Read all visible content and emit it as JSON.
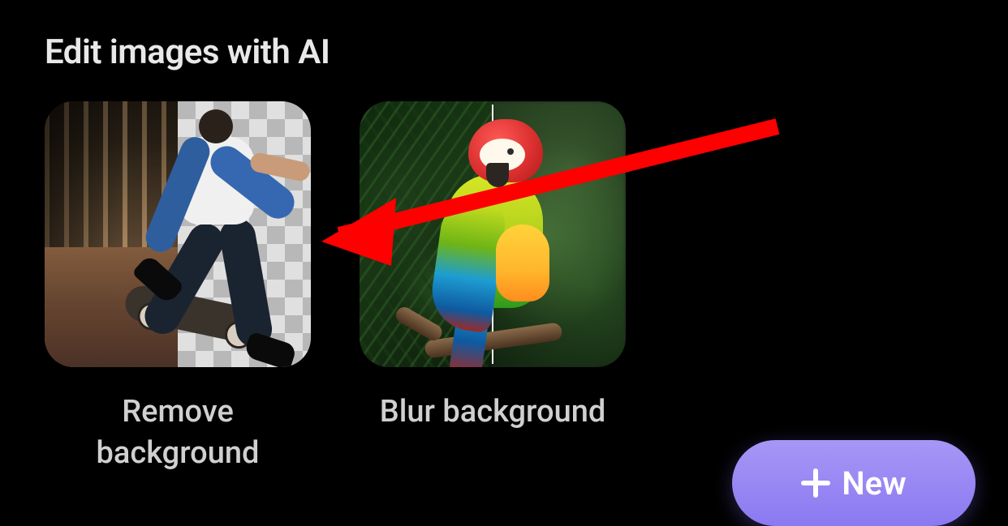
{
  "section": {
    "title": "Edit images with AI"
  },
  "cards": {
    "removeBg": {
      "label": "Remove background"
    },
    "blurBg": {
      "label": "Blur background"
    }
  },
  "actions": {
    "newLabel": "New"
  },
  "annotation": {
    "arrowColor": "#ff0000",
    "target": "removeBg"
  }
}
